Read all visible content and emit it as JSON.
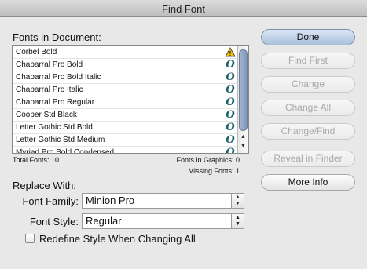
{
  "window": {
    "title": "Find Font"
  },
  "fonts_section": {
    "label": "Fonts in Document:",
    "rows": [
      {
        "name": "Corbel Bold",
        "icon": "warning-icon"
      },
      {
        "name": "Chaparral Pro Bold",
        "icon": "opentype-icon"
      },
      {
        "name": "Chaparral Pro Bold Italic",
        "icon": "opentype-icon"
      },
      {
        "name": "Chaparral Pro Italic",
        "icon": "opentype-icon"
      },
      {
        "name": "Chaparral Pro Regular",
        "icon": "opentype-icon"
      },
      {
        "name": "Cooper Std Black",
        "icon": "opentype-icon"
      },
      {
        "name": "Letter Gothic Std Bold",
        "icon": "opentype-icon"
      },
      {
        "name": "Letter Gothic Std Medium",
        "icon": "opentype-icon"
      },
      {
        "name": "Myriad Pro Bold Condensed",
        "icon": "opentype-icon"
      }
    ],
    "icon_glyph": "O",
    "warning_glyph": "!",
    "total_fonts": "Total Fonts: 10",
    "fonts_in_graphics": "Fonts in Graphics: 0",
    "missing_fonts": "Missing Fonts: 1"
  },
  "buttons": {
    "done": "Done",
    "find_first": "Find First",
    "change": "Change",
    "change_all": "Change All",
    "change_find": "Change/Find",
    "reveal_in_finder": "Reveal in Finder",
    "more_info": "More Info"
  },
  "replace": {
    "label": "Replace With:",
    "family_label": "Font Family:",
    "family_value": "Minion Pro",
    "style_label": "Font Style:",
    "style_value": "Regular",
    "redefine_label": "Redefine Style When Changing All",
    "redefine_checked": false
  },
  "colors": {
    "accent_button": "#a9bfdb",
    "warning": "#f2c200",
    "opentype_icon": "#1a5f6a"
  }
}
